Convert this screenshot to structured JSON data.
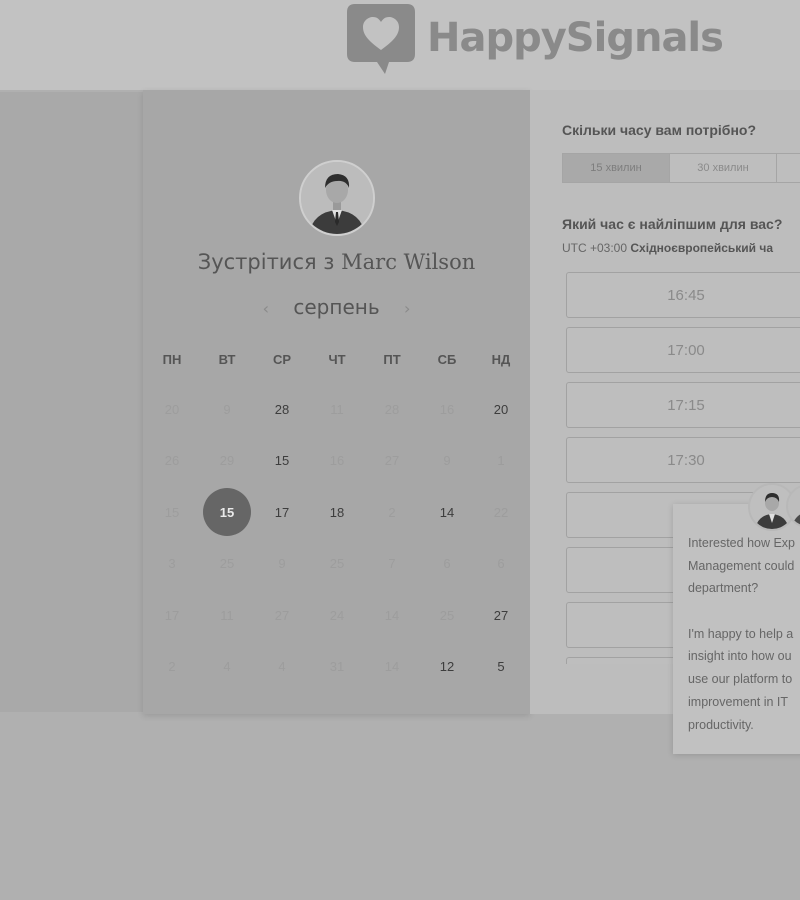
{
  "header": {
    "brand": "HappySignals"
  },
  "calendar": {
    "meet_prefix": "Зустрітися з ",
    "meet_name": "Marc Wilson",
    "month": "серпень",
    "prev_icon": "‹",
    "next_icon": "›",
    "weekdays": [
      "ПН",
      "ВТ",
      "СР",
      "ЧТ",
      "ПТ",
      "СБ",
      "НД"
    ],
    "weeks": [
      [
        {
          "d": "20",
          "on": false
        },
        {
          "d": "9",
          "on": false
        },
        {
          "d": "28",
          "on": true
        },
        {
          "d": "11",
          "on": false
        },
        {
          "d": "28",
          "on": false
        },
        {
          "d": "16",
          "on": false
        },
        {
          "d": "20",
          "on": true
        }
      ],
      [
        {
          "d": "26",
          "on": false
        },
        {
          "d": "29",
          "on": false
        },
        {
          "d": "15",
          "on": true
        },
        {
          "d": "16",
          "on": false
        },
        {
          "d": "27",
          "on": false
        },
        {
          "d": "9",
          "on": false
        },
        {
          "d": "1",
          "on": false
        }
      ],
      [
        {
          "d": "15",
          "on": false
        },
        {
          "d": "15",
          "on": true,
          "selected": true
        },
        {
          "d": "17",
          "on": true
        },
        {
          "d": "18",
          "on": true
        },
        {
          "d": "2",
          "on": false
        },
        {
          "d": "14",
          "on": true
        },
        {
          "d": "22",
          "on": false
        }
      ],
      [
        {
          "d": "3",
          "on": false
        },
        {
          "d": "25",
          "on": false
        },
        {
          "d": "9",
          "on": false
        },
        {
          "d": "25",
          "on": false
        },
        {
          "d": "7",
          "on": false
        },
        {
          "d": "6",
          "on": false
        },
        {
          "d": "6",
          "on": false
        }
      ],
      [
        {
          "d": "17",
          "on": false
        },
        {
          "d": "11",
          "on": false
        },
        {
          "d": "27",
          "on": false
        },
        {
          "d": "24",
          "on": false
        },
        {
          "d": "14",
          "on": false
        },
        {
          "d": "25",
          "on": false
        },
        {
          "d": "27",
          "on": true
        }
      ],
      [
        {
          "d": "2",
          "on": false
        },
        {
          "d": "4",
          "on": false
        },
        {
          "d": "4",
          "on": false
        },
        {
          "d": "31",
          "on": false
        },
        {
          "d": "14",
          "on": false
        },
        {
          "d": "12",
          "on": true
        },
        {
          "d": "5",
          "on": true
        }
      ]
    ]
  },
  "booking": {
    "duration_question": "Скільки часу вам потрібно?",
    "durations": [
      {
        "label": "15 хвилин",
        "active": true
      },
      {
        "label": "30 хвилин",
        "active": false
      },
      {
        "label": "",
        "active": false
      }
    ],
    "time_question": "Який час є найліпшим для вас?",
    "tz_offset": "UTC +03:00",
    "tz_name": "Східноєвропейський ча",
    "slots": [
      "16:45",
      "17:00",
      "17:15",
      "17:30",
      "",
      "",
      "",
      ""
    ]
  },
  "chat": {
    "lines": [
      "Interested how Exp",
      "Management could",
      "department?",
      "",
      "I'm happy to help a",
      "insight into how ou",
      "use our platform to",
      "improvement in IT",
      "productivity."
    ]
  },
  "colors": {
    "selected_day": "#666666",
    "background": "#b0b0b0"
  }
}
